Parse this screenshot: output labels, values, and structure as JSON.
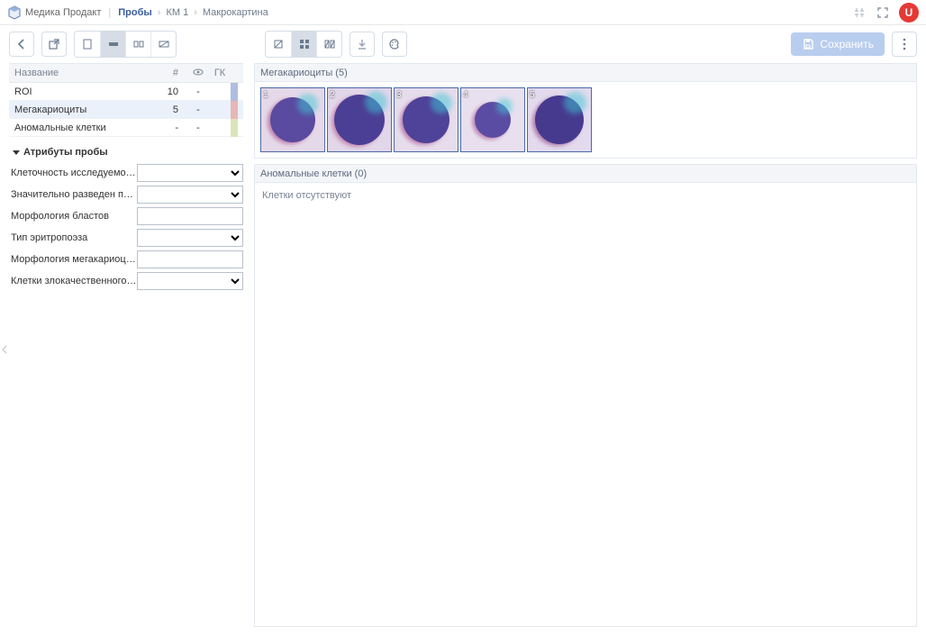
{
  "header": {
    "brand": "Медика Продакт",
    "breadcrumb": [
      "Пробы",
      "КМ 1",
      "Макрокартина"
    ],
    "avatar_letter": "U"
  },
  "save_label": "Сохранить",
  "table": {
    "headers": {
      "name": "Название",
      "count": "#",
      "eye": "👁",
      "gk": "ГК"
    },
    "rows": [
      {
        "name": "ROI",
        "count": "10",
        "eye": "-",
        "swatch": "sw-blue",
        "selected": false
      },
      {
        "name": "Мегакариоциты",
        "count": "5",
        "eye": "-",
        "swatch": "sw-pink",
        "selected": true
      },
      {
        "name": "Аномальные клетки",
        "count": "-",
        "eye": "-",
        "swatch": "sw-green",
        "selected": false
      }
    ]
  },
  "attrs": {
    "title": "Атрибуты пробы",
    "rows": [
      {
        "label": "Клеточность исследуемого …",
        "kind": "select"
      },
      {
        "label": "Значительно разведен пери…",
        "kind": "select"
      },
      {
        "label": "Морфология бластов",
        "kind": "text"
      },
      {
        "label": "Тип эритропоэза",
        "kind": "select"
      },
      {
        "label": "Морфология мегакариоцитов",
        "kind": "text"
      },
      {
        "label": "Клетки злокачественного но…",
        "kind": "select"
      }
    ]
  },
  "sections": [
    {
      "title": "Мегакариоциты (5)",
      "thumbs": 5
    },
    {
      "title": "Аномальные клетки (0)",
      "empty_msg": "Клетки отсутствуют"
    }
  ]
}
